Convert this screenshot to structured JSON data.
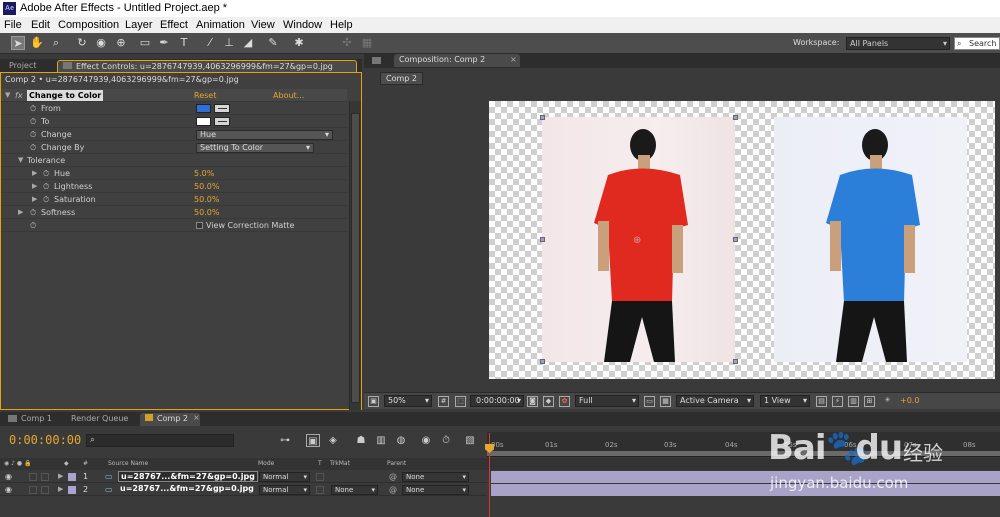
{
  "window": {
    "title": "Adobe After Effects - Untitled Project.aep *",
    "app_icon": "Ae"
  },
  "menu": [
    "File",
    "Edit",
    "Composition",
    "Layer",
    "Effect",
    "Animation",
    "View",
    "Window",
    "Help"
  ],
  "toolbar": {
    "workspace_label": "Workspace:",
    "workspace_value": "All Panels",
    "search_placeholder": "Search",
    "tools": [
      "selection-tool",
      "hand-tool",
      "zoom-tool",
      "rotation-tool",
      "camera-tool",
      "pan-behind-tool",
      "rectangle-tool",
      "pen-tool",
      "type-tool",
      "brush-tool",
      "clone-stamp-tool",
      "eraser-tool",
      "roto-brush-tool",
      "puppet-pin-tool"
    ]
  },
  "effect_panel": {
    "tabs": [
      "Project",
      "Effect Controls: u=2876747939,4063296999&fm=27&gp=0.jpg"
    ],
    "subtitle": "Comp 2 • u=2876747939,4063296999&fm=27&gp=0.jpg",
    "effect_name": "Change to Color",
    "reset": "Reset",
    "about": "About...",
    "fx": "fx",
    "rows": {
      "from": {
        "label": "From",
        "color": "#2f6fd6"
      },
      "to": {
        "label": "To",
        "color": "#ffffff"
      },
      "change": {
        "label": "Change",
        "value": "Hue"
      },
      "change_by": {
        "label": "Change By",
        "value": "Setting To Color"
      },
      "tolerance": {
        "label": "Tolerance"
      },
      "hue": {
        "label": "Hue",
        "value": "5.0%"
      },
      "lightness": {
        "label": "Lightness",
        "value": "50.0%"
      },
      "saturation": {
        "label": "Saturation",
        "value": "50.0%"
      },
      "softness": {
        "label": "Softness",
        "value": "50.0%"
      },
      "matte": {
        "label": "View Correction Matte"
      }
    }
  },
  "comp_panel": {
    "tab": "Composition: Comp 2",
    "sub_tab": "Comp 2",
    "zoom": "50%",
    "timecode": "0:00:00:00",
    "resolution": "Full",
    "camera": "Active Camera",
    "views": "1 View",
    "exposure": "+0.0"
  },
  "timeline": {
    "tabs": [
      "Comp 1",
      "Render Queue",
      "Comp 2"
    ],
    "current_time": "0:00:00:00",
    "ruler": [
      "00s",
      "01s",
      "02s",
      "03s",
      "04s",
      "05s",
      "06s",
      "07s",
      "08s"
    ],
    "columns": {
      "source": "Source Name",
      "mode": "Mode",
      "t": "T",
      "trkmat": "TrkMat",
      "parent": "Parent",
      "num": "#"
    },
    "layers": [
      {
        "num": "1",
        "name": "u=28767...&fm=27&gp=0.jpg",
        "mode": "Normal",
        "trkmat": "",
        "parent": "None"
      },
      {
        "num": "2",
        "name": "u=28767...&fm=27&gp=0.jpg",
        "mode": "Normal",
        "trkmat": "None",
        "parent": "None"
      }
    ]
  },
  "watermark": {
    "brand": "Bai",
    "brand2": "du",
    "cn": "经验",
    "url": "jingyan.baidu.com"
  }
}
